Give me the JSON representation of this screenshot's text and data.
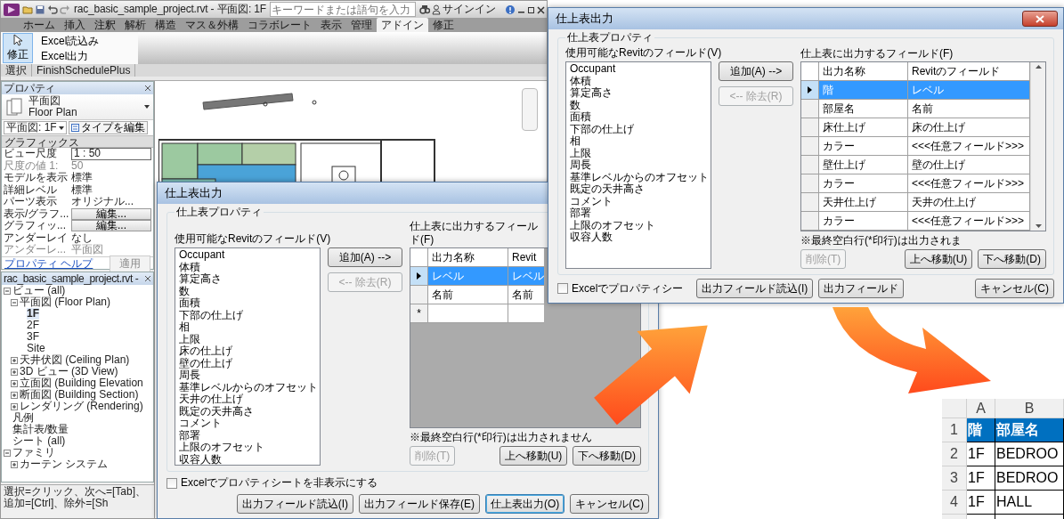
{
  "revit_window": {
    "title": "rac_basic_sample_project.rvt - 平面図: 1F",
    "search": {
      "placeholder": "キーワードまたは語句を入力"
    },
    "sign_in": "サインイン",
    "ribbon_tabs": [
      {
        "label": "ホーム",
        "selected": false
      },
      {
        "label": "挿入",
        "selected": false
      },
      {
        "label": "注釈",
        "selected": false
      },
      {
        "label": "解析",
        "selected": false
      },
      {
        "label": "構造",
        "selected": false
      },
      {
        "label": "マス＆外構",
        "selected": false
      },
      {
        "label": "コラボレート",
        "selected": false
      },
      {
        "label": "表示",
        "selected": false
      },
      {
        "label": "管理",
        "selected": false
      },
      {
        "label": "アドイン",
        "selected": true
      },
      {
        "label": "修正",
        "selected": false
      }
    ],
    "ribbon_tools": [
      {
        "label": "修正",
        "kind": "large",
        "active": true
      },
      {
        "label": "Excel読込み",
        "kind": "small",
        "active": false
      },
      {
        "label": "Excel出力",
        "kind": "small",
        "active": false
      }
    ],
    "ribbon_panels": [
      "選択",
      "FinishSchedulePlus"
    ],
    "properties": {
      "title": "プロパティ",
      "type_name": "平面図",
      "type_category": "Floor Plan",
      "view_selector": "平面図: 1F",
      "edit_type_button": "タイプを編集",
      "section": "グラフィックス",
      "rows": [
        {
          "name": "ビュー尺度",
          "value": "1 : 50",
          "kind": "field",
          "disabled": false
        },
        {
          "name": "尺度の値 1:",
          "value": "50",
          "kind": "text",
          "disabled": true
        },
        {
          "name": "モデルを表示",
          "value": "標準",
          "kind": "text",
          "disabled": false
        },
        {
          "name": "詳細レベル",
          "value": "標準",
          "kind": "text",
          "disabled": false
        },
        {
          "name": "パーツ表示",
          "value": "オリジナル...",
          "kind": "text",
          "disabled": false
        },
        {
          "name": "表示/グラフ...",
          "value": "編集...",
          "kind": "button",
          "disabled": false
        },
        {
          "name": "グラフィッ...",
          "value": "編集...",
          "kind": "button",
          "disabled": false
        },
        {
          "name": "アンダーレイ",
          "value": "なし",
          "kind": "text",
          "disabled": false
        },
        {
          "name": "アンダーレ...",
          "value": "平面図",
          "kind": "text",
          "disabled": true
        }
      ],
      "help_link": "プロパティ ヘルプ",
      "apply_button": {
        "label": "適用",
        "disabled": true
      }
    },
    "project_browser": {
      "title": "rac_basic_sample_project.rvt -",
      "tree": [
        {
          "label": "ビュー (all)",
          "expanded": true,
          "selected": false,
          "children": [
            {
              "label": "平面図 (Floor Plan)",
              "expanded": true,
              "selected": false,
              "children": [
                {
                  "label": "1F",
                  "selected": true
                },
                {
                  "label": "2F",
                  "selected": false
                },
                {
                  "label": "3F",
                  "selected": false
                },
                {
                  "label": "Site",
                  "selected": false
                }
              ]
            },
            {
              "label": "天井伏図 (Ceiling Plan)",
              "expanded": false,
              "selected": false
            },
            {
              "label": "3D ビュー (3D View)",
              "expanded": false,
              "selected": false
            },
            {
              "label": "立面図 (Building Elevation",
              "expanded": false,
              "selected": false
            },
            {
              "label": "断面図 (Building Section)",
              "expanded": false,
              "selected": false
            },
            {
              "label": "レンダリング (Rendering)",
              "expanded": false,
              "selected": false
            }
          ]
        },
        {
          "label": "凡例",
          "selected": false
        },
        {
          "label": "集計表/数量",
          "selected": false
        },
        {
          "label": "シート (all)",
          "selected": false
        },
        {
          "label": "ファミリ",
          "expanded": true,
          "selected": false,
          "children": [
            {
              "label": "カーテン システム",
              "expanded": false,
              "selected": false
            }
          ]
        }
      ]
    },
    "status_bar": "選択=クリック、次へ=[Tab]、追加=[Ctrl]、除外=[Sh"
  },
  "dialogs": [
    {
      "title": "仕上表出力",
      "close_button": false,
      "group_label": "仕上表プロパティ",
      "available_label": "使用可能なRevitのフィールド(V)",
      "available_fields": [
        "Occupant",
        "体積",
        "算定高さ",
        "数",
        "面積",
        "下部の仕上げ",
        "相",
        "上限",
        "床の仕上げ",
        "壁の仕上げ",
        "周長",
        "基準レベルからのオフセット",
        "天井の仕上げ",
        "既定の天井高さ",
        "コメント",
        "部署",
        "上限のオフセット",
        "収容人数"
      ],
      "add_button": {
        "label": "追加(A) -->",
        "disabled": false
      },
      "remove_button": {
        "label": "<-- 除去(R)",
        "disabled": true
      },
      "output_label": "仕上表に出力するフィールド(F)",
      "columns": [
        "出力名称",
        "Revit"
      ],
      "rows": [
        {
          "name": "レベル",
          "field": "レベル",
          "selected": true
        },
        {
          "name": "名前",
          "field": "名前",
          "selected": false
        }
      ],
      "new_row_marker": "*",
      "note": "※最終空白行(*印行)は出力されません",
      "delete_button": {
        "label": "削除(T)",
        "disabled": true
      },
      "move_buttons": [
        {
          "label": "上へ移動(U)",
          "disabled": false
        },
        {
          "label": "下へ移動(D)",
          "disabled": false
        }
      ],
      "hide_sheet_checkbox": {
        "label": "Excelでプロパティシートを非表示にする",
        "checked": false
      },
      "footer_buttons": [
        {
          "label": "出力フィールド読込(I)",
          "default": false
        },
        {
          "label": "出力フィールド保存(E)",
          "default": false
        },
        {
          "label": "仕上表出力(O)",
          "default": true
        },
        {
          "label": "キャンセル(C)",
          "default": false
        }
      ]
    },
    {
      "title": "仕上表出力",
      "close_button": true,
      "group_label": "仕上表プロパティ",
      "available_label": "使用可能なRevitのフィールド(V)",
      "available_fields": [
        "Occupant",
        "体積",
        "算定高さ",
        "数",
        "面積",
        "下部の仕上げ",
        "相",
        "上限",
        "周長",
        "基準レベルからのオフセット",
        "既定の天井高さ",
        "コメント",
        "部署",
        "上限のオフセット",
        "収容人数"
      ],
      "add_button": {
        "label": "追加(A) -->",
        "disabled": false
      },
      "remove_button": {
        "label": "<-- 除去(R)",
        "disabled": true
      },
      "output_label": "仕上表に出力するフィールド(F)",
      "columns": [
        "出力名称",
        "Revitのフィールド"
      ],
      "rows": [
        {
          "name": "階",
          "field": "レベル",
          "selected": true
        },
        {
          "name": "部屋名",
          "field": "名前",
          "selected": false
        },
        {
          "name": "床仕上げ",
          "field": "床の仕上げ",
          "selected": false
        },
        {
          "name": "カラー",
          "field": "<<<任意フィールド>>>",
          "selected": false
        },
        {
          "name": "壁仕上げ",
          "field": "壁の仕上げ",
          "selected": false
        },
        {
          "name": "カラー",
          "field": "<<<任意フィールド>>>",
          "selected": false
        },
        {
          "name": "天井仕上げ",
          "field": "天井の仕上げ",
          "selected": false
        },
        {
          "name": "カラー",
          "field": "<<<任意フィールド>>>",
          "selected": false
        }
      ],
      "note": "※最終空白行(*印行)は出力されま",
      "delete_button": {
        "label": "削除(T)",
        "disabled": true
      },
      "move_buttons": [
        {
          "label": "上へ移動(U)",
          "disabled": false
        },
        {
          "label": "下へ移動(D)",
          "disabled": false
        }
      ],
      "hide_sheet_checkbox": {
        "label": "Excelでプロパティシー",
        "checked": false
      },
      "footer_buttons": [
        {
          "label": "出力フィールド読込(I)",
          "default": false
        },
        {
          "label": "出力フィールド",
          "default": false
        },
        {
          "label": "キャンセル(C)",
          "default": false
        }
      ]
    }
  ],
  "spreadsheet": {
    "column_headers": [
      "A",
      "B"
    ],
    "rows": [
      {
        "number": "1",
        "kind": "header",
        "cells": [
          "階",
          "部屋名"
        ]
      },
      {
        "number": "2",
        "kind": "data",
        "cells": [
          "1F",
          "BEDROO"
        ]
      },
      {
        "number": "3",
        "kind": "data",
        "cells": [
          "1F",
          "BEDROO"
        ]
      },
      {
        "number": "4",
        "kind": "data",
        "cells": [
          "1F",
          "HALL"
        ]
      }
    ]
  }
}
